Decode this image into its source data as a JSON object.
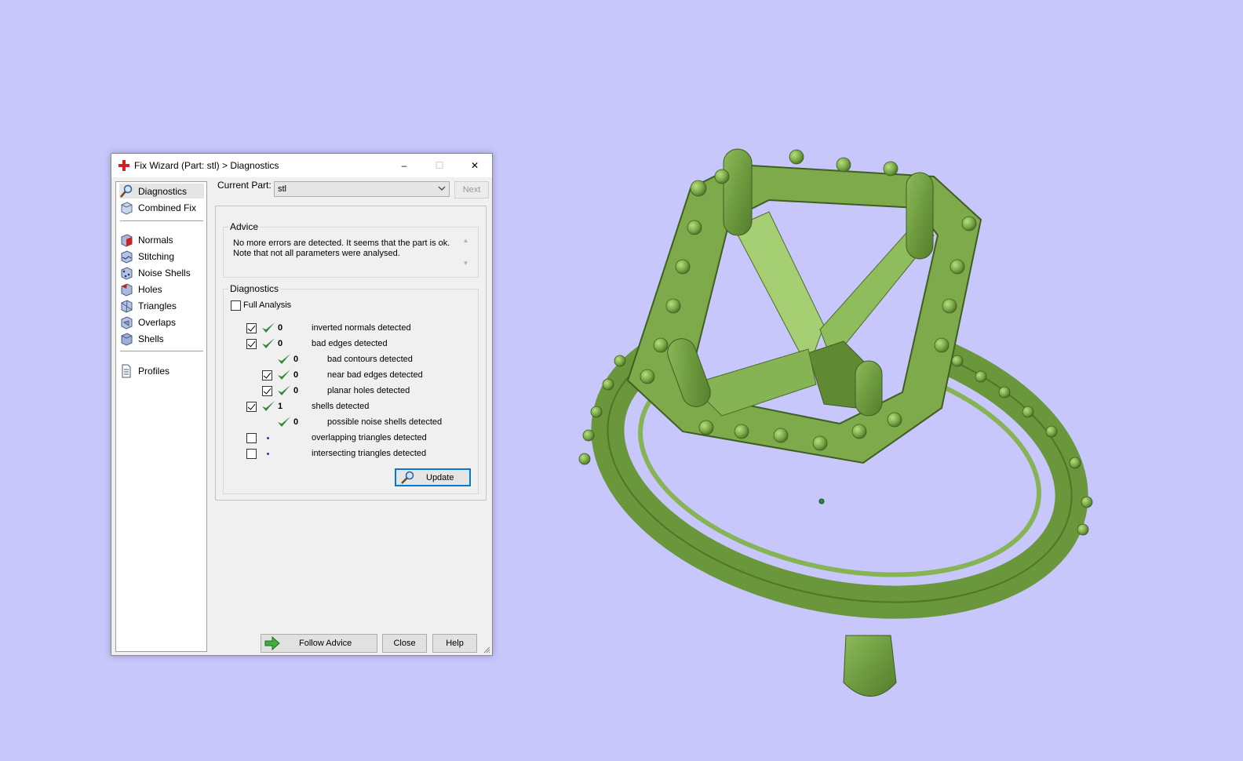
{
  "window": {
    "title": "Fix Wizard (Part: stl) > Diagnostics",
    "icon": "red-cross-icon",
    "controls": {
      "minimize": "–",
      "maximize": "☐",
      "close": "✕"
    }
  },
  "sidebar": {
    "items": [
      {
        "label": "Diagnostics",
        "icon": "magnifier-icon",
        "selected": true
      },
      {
        "label": "Combined Fix",
        "icon": "cube-icon"
      },
      {
        "label": "Normals",
        "icon": "cube-red-face-icon"
      },
      {
        "label": "Stitching",
        "icon": "cube-stitch-icon"
      },
      {
        "label": "Noise Shells",
        "icon": "cube-noise-icon"
      },
      {
        "label": "Holes",
        "icon": "cube-holes-icon"
      },
      {
        "label": "Triangles",
        "icon": "cube-triangles-icon"
      },
      {
        "label": "Overlaps",
        "icon": "cube-overlaps-icon"
      },
      {
        "label": "Shells",
        "icon": "cube-shells-icon"
      },
      {
        "label": "Profiles",
        "icon": "document-icon"
      }
    ]
  },
  "current_part": {
    "label": "Current Part:",
    "value": "stl",
    "next_label": "Next"
  },
  "advice": {
    "group_label": "Advice",
    "line1": "No more errors are detected. It seems that the part is ok.",
    "line2": "Note that not all parameters were analysed."
  },
  "diagnostics": {
    "group_label": "Diagnostics",
    "full_analysis_label": "Full Analysis",
    "full_analysis_checked": false,
    "rows": [
      {
        "checkbox": true,
        "checked": true,
        "status": "ok",
        "count": "0",
        "label": "inverted normals detected",
        "indent": 0
      },
      {
        "checkbox": true,
        "checked": true,
        "status": "ok",
        "count": "0",
        "label": "bad edges detected",
        "indent": 0
      },
      {
        "checkbox": false,
        "checked": false,
        "status": "ok",
        "count": "0",
        "label": "bad contours detected",
        "indent": 1
      },
      {
        "checkbox": true,
        "checked": true,
        "status": "ok",
        "count": "0",
        "label": "near bad edges detected",
        "indent": 1
      },
      {
        "checkbox": true,
        "checked": true,
        "status": "ok",
        "count": "0",
        "label": "planar holes detected",
        "indent": 1
      },
      {
        "checkbox": true,
        "checked": true,
        "status": "ok",
        "count": "1",
        "label": "shells detected",
        "indent": 0
      },
      {
        "checkbox": false,
        "checked": false,
        "status": "ok",
        "count": "0",
        "label": "possible noise shells detected",
        "indent": 1
      },
      {
        "checkbox": true,
        "checked": false,
        "status": "pending",
        "count": "",
        "label": "overlapping triangles detected",
        "indent": 0
      },
      {
        "checkbox": true,
        "checked": false,
        "status": "pending",
        "count": "",
        "label": "intersecting triangles detected",
        "indent": 0
      }
    ],
    "update_label": "Update"
  },
  "footer": {
    "follow_advice_label": "Follow Advice",
    "close_label": "Close",
    "help_label": "Help"
  },
  "colors": {
    "viewport_bg": "#c7c7fb",
    "model_green": "#79a84a",
    "tick_green": "#2e8b3a",
    "focus_blue": "#0078d7"
  }
}
